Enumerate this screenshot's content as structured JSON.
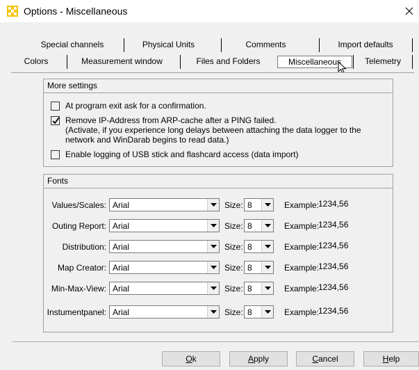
{
  "window": {
    "title": "Options - Miscellaneous",
    "accent": "#f5c400"
  },
  "tabs": {
    "row1": [
      "Special channels",
      "Physical Units",
      "Comments",
      "Import defaults"
    ],
    "row2": [
      "Colors",
      "Measurement window",
      "Files and Folders",
      "Miscellaneous",
      "Telemetry"
    ],
    "active": "Miscellaneous"
  },
  "more_settings": {
    "header": "More settings",
    "options": [
      {
        "label": "At program exit ask for a confirmation.",
        "checked": false
      },
      {
        "label": "Remove IP-Address from ARP-cache after a PING failed.",
        "sub1": "(Activate, if you experience long delays between attaching the data logger to the",
        "sub2": "network and WinDarab begins to read data.)",
        "checked": true
      },
      {
        "label": "Enable logging of USB stick and flashcard access (data import)",
        "checked": false
      }
    ]
  },
  "fonts": {
    "header": "Fonts",
    "size_label": "Size:",
    "example_label": "Example:",
    "rows": [
      {
        "label": "Values/Scales:",
        "font": "Arial",
        "size": "8",
        "example": "1234,56"
      },
      {
        "label": "Outing Report:",
        "font": "Arial",
        "size": "8",
        "example": "1234,56"
      },
      {
        "label": "Distribution:",
        "font": "Arial",
        "size": "8",
        "example": "1234,56"
      },
      {
        "label": "Map Creator:",
        "font": "Arial",
        "size": "8",
        "example": "1234,56"
      },
      {
        "label": "Min-Max-View:",
        "font": "Arial",
        "size": "8",
        "example": "1234,56"
      },
      {
        "label": "Instumentpanel:",
        "font": "Arial",
        "size": "8",
        "example": "1234,56"
      }
    ]
  },
  "buttons": {
    "ok": {
      "mnemonic": "O",
      "rest": "k"
    },
    "apply": {
      "mnemonic": "A",
      "rest": "pply"
    },
    "cancel": {
      "mnemonic": "C",
      "rest": "ancel"
    },
    "help": {
      "mnemonic": "H",
      "rest": "elp"
    }
  }
}
